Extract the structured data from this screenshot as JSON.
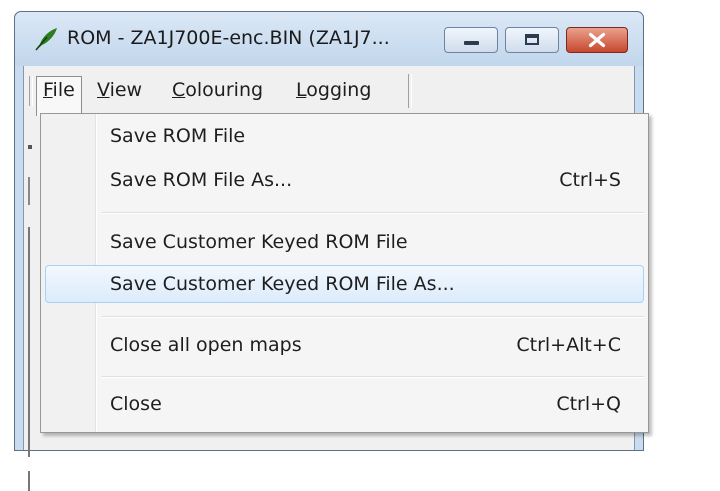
{
  "window": {
    "title": "ROM - ZA1J700E-enc.BIN (ZA1J7..."
  },
  "menubar": {
    "items": [
      {
        "label": "File",
        "mnemonic": "F",
        "rest": "ile"
      },
      {
        "label": "View",
        "mnemonic": "V",
        "rest": "iew"
      },
      {
        "label": "Colouring",
        "mnemonic": "C",
        "rest": "olouring"
      },
      {
        "label": "Logging",
        "mnemonic": "L",
        "rest": "ogging"
      }
    ]
  },
  "file_menu": {
    "items": [
      {
        "label": "Save ROM File",
        "shortcut": ""
      },
      {
        "label": "Save ROM File As...",
        "shortcut": "Ctrl+S"
      },
      {
        "label": "Save Customer Keyed ROM File",
        "shortcut": ""
      },
      {
        "label": "Save Customer Keyed ROM File As...",
        "shortcut": ""
      },
      {
        "label": "Close all open maps",
        "shortcut": "Ctrl+Alt+C"
      },
      {
        "label": "Close",
        "shortcut": "Ctrl+Q"
      }
    ]
  },
  "colors": {
    "titlebar": "#c9dcef",
    "close_button": "#c8472e",
    "hover_highlight": "#dcebfc"
  }
}
